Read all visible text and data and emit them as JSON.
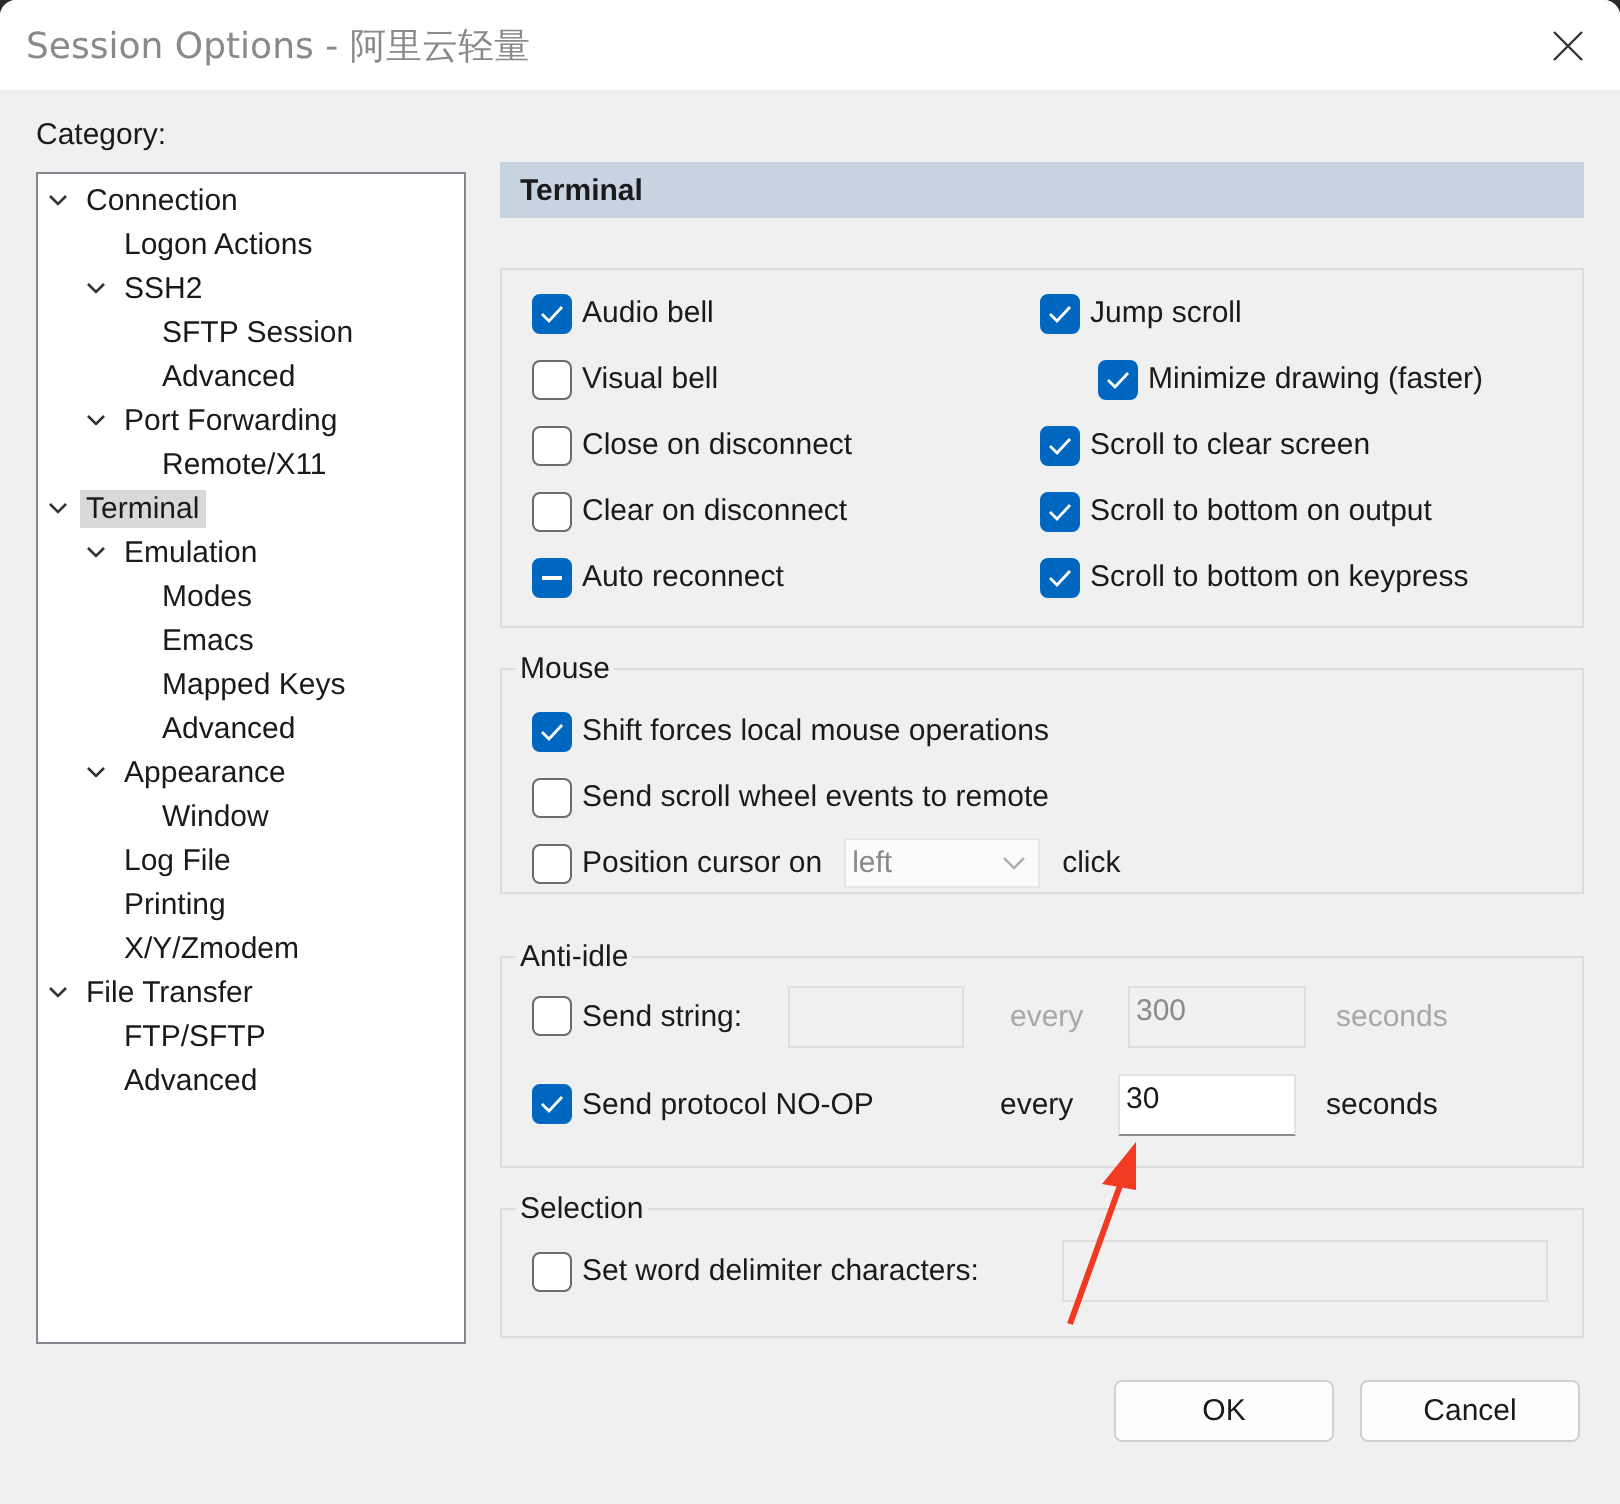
{
  "window": {
    "title": "Session Options - 阿里云轻量"
  },
  "category_label": "Category:",
  "tree": [
    {
      "label": "Connection",
      "expanded": true,
      "selected": false,
      "children": [
        {
          "label": "Logon Actions",
          "selected": false
        },
        {
          "label": "SSH2",
          "expanded": true,
          "selected": false,
          "children": [
            {
              "label": "SFTP Session",
              "selected": false
            },
            {
              "label": "Advanced",
              "selected": false
            }
          ]
        },
        {
          "label": "Port Forwarding",
          "expanded": true,
          "selected": false,
          "children": [
            {
              "label": "Remote/X11",
              "selected": false
            }
          ]
        }
      ]
    },
    {
      "label": "Terminal",
      "expanded": true,
      "selected": true,
      "children": [
        {
          "label": "Emulation",
          "expanded": true,
          "selected": false,
          "children": [
            {
              "label": "Modes",
              "selected": false
            },
            {
              "label": "Emacs",
              "selected": false
            },
            {
              "label": "Mapped Keys",
              "selected": false
            },
            {
              "label": "Advanced",
              "selected": false
            }
          ]
        },
        {
          "label": "Appearance",
          "expanded": true,
          "selected": false,
          "children": [
            {
              "label": "Window",
              "selected": false
            }
          ]
        },
        {
          "label": "Log File",
          "selected": false
        },
        {
          "label": "Printing",
          "selected": false
        },
        {
          "label": "X/Y/Zmodem",
          "selected": false
        }
      ]
    },
    {
      "label": "File Transfer",
      "expanded": true,
      "selected": false,
      "children": [
        {
          "label": "FTP/SFTP",
          "selected": false
        },
        {
          "label": "Advanced",
          "selected": false
        }
      ]
    }
  ],
  "panel": {
    "title": "Terminal"
  },
  "terminal_options": {
    "left": [
      {
        "label": "Audio bell",
        "checked": true,
        "indeterminate": false
      },
      {
        "label": "Visual bell",
        "checked": false,
        "indeterminate": false
      },
      {
        "label": "Close on disconnect",
        "checked": false,
        "indeterminate": false
      },
      {
        "label": "Clear on disconnect",
        "checked": false,
        "indeterminate": false
      },
      {
        "label": "Auto reconnect",
        "checked": true,
        "indeterminate": true
      }
    ],
    "right": [
      {
        "label": "Jump scroll",
        "checked": true,
        "indeterminate": false,
        "children": [
          {
            "label": "Minimize drawing (faster)",
            "checked": true,
            "indeterminate": false
          }
        ]
      },
      {
        "label": "Scroll to clear screen",
        "checked": true,
        "indeterminate": false
      },
      {
        "label": "Scroll to bottom on output",
        "checked": true,
        "indeterminate": false
      },
      {
        "label": "Scroll to bottom on keypress",
        "checked": true,
        "indeterminate": false
      }
    ]
  },
  "mouse": {
    "title": "Mouse",
    "options": [
      {
        "kind": "plain",
        "label": "Shift forces local mouse operations",
        "checked": true
      },
      {
        "kind": "plain",
        "label": "Send scroll wheel events to remote",
        "checked": false
      },
      {
        "kind": "dropdown",
        "label": "Position cursor on",
        "checked": false,
        "dropdown": {
          "value": "left",
          "disabled": true
        },
        "suffix": "click"
      }
    ]
  },
  "anti_idle": {
    "title": "Anti-idle",
    "rows": [
      {
        "kind": "string",
        "label": "Send string:",
        "checked": false,
        "disabled": true,
        "every": "every",
        "interval": "300",
        "unit": "seconds"
      },
      {
        "kind": "noop",
        "label": "Send protocol NO-OP",
        "checked": true,
        "disabled": false,
        "every": "every",
        "interval": "30",
        "unit": "seconds"
      }
    ]
  },
  "selection": {
    "title": "Selection",
    "options": [
      {
        "label": "Set word delimiter characters:",
        "checked": false,
        "field_disabled": true
      }
    ]
  },
  "buttons": [
    {
      "label": "OK"
    },
    {
      "label": "Cancel"
    }
  ]
}
